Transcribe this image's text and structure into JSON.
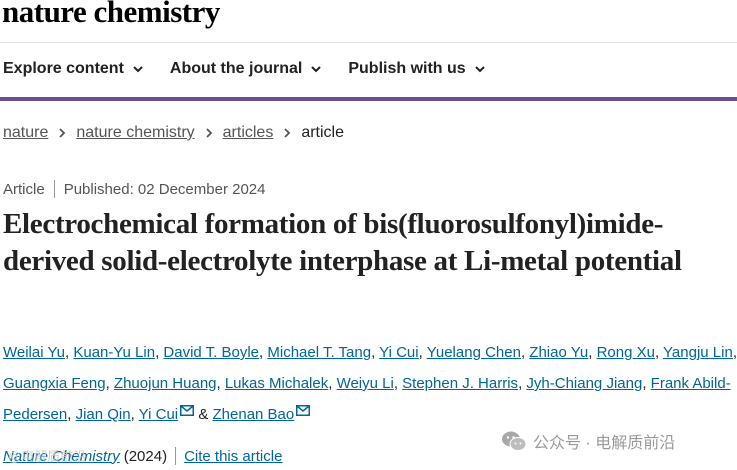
{
  "header": {
    "logo_text": "nature chemistry",
    "nav": [
      {
        "label": "Explore content"
      },
      {
        "label": "About the journal"
      },
      {
        "label": "Publish with us"
      }
    ]
  },
  "breadcrumb": {
    "items": [
      "nature",
      "nature chemistry",
      "articles"
    ],
    "current": "article"
  },
  "article": {
    "type": "Article",
    "published": "Published: 02 December 2024",
    "title": "Electrochemical formation of bis(fluorosulfonyl)imide-derived solid-electrolyte interphase at Li-metal potential",
    "authors": [
      "Weilai Yu",
      "Kuan-Yu Lin",
      "David T. Boyle",
      "Michael T. Tang",
      "Yi Cui",
      "Yuelang Chen",
      "Zhiao Yu",
      "Rong Xu",
      "Yangju Lin",
      "Guangxia Feng",
      "Zhuojun Huang",
      "Lukas Michalek",
      "Weiyu Li",
      "Stephen J. Harris",
      "Jyh-Chiang Jiang",
      "Frank Abild-Pedersen",
      "Jian Qin",
      "Yi Cui",
      "Zhenan Bao"
    ],
    "author_connector": "&",
    "journal": "Nature Chemistry",
    "year": "(2024)",
    "cite_label": "Cite this article"
  },
  "watermark": {
    "left_text": "@电解质前沿",
    "right_text": "公众号 · 电解质前沿"
  },
  "colors": {
    "link": "#006699",
    "accent_bar": "#6b4d8f"
  }
}
